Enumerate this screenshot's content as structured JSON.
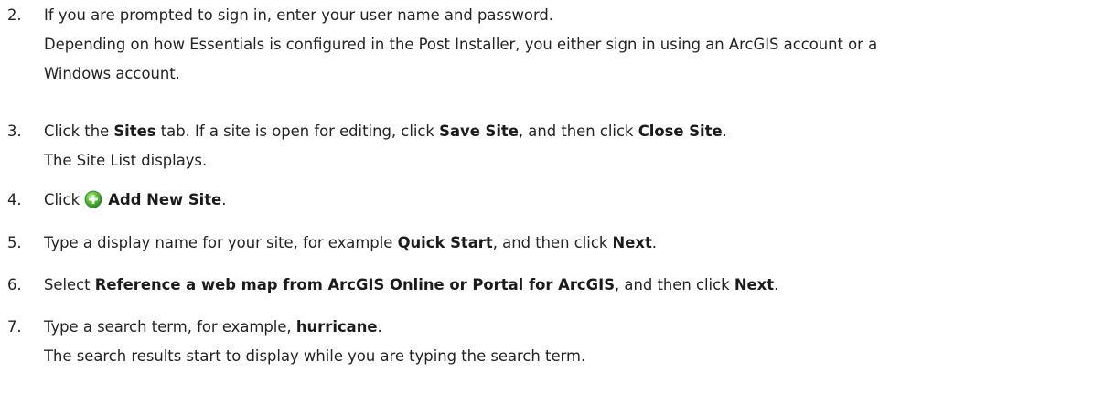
{
  "steps": [
    {
      "number": "2.",
      "parts": [
        "If you are prompted to sign in, enter your user name and password."
      ],
      "subtext": [
        "Depending on how Essentials is configured in the Post Installer, you either sign in using an ArcGIS account or a",
        "Windows account."
      ]
    },
    {
      "number": "3.",
      "parts": [
        "Click the ",
        "Sites",
        " tab. If a site is open for editing, click ",
        "Save Site",
        ", and then click ",
        "Close Site",
        "."
      ],
      "subtext": [
        "The Site List displays."
      ]
    },
    {
      "number": "4.",
      "parts": [
        "Click ",
        "Add New Site",
        "."
      ],
      "icon": "add-circle-icon"
    },
    {
      "number": "5.",
      "parts": [
        "Type a display name for your site, for example ",
        "Quick Start",
        ", and then click ",
        "Next",
        "."
      ]
    },
    {
      "number": "6.",
      "parts": [
        "Select ",
        "Reference a web map from ArcGIS Online or Portal for ArcGIS",
        ", and then click ",
        "Next",
        "."
      ]
    },
    {
      "number": "7.",
      "parts": [
        "Type a search term, for example, ",
        "hurricane",
        "."
      ],
      "subtext": [
        "The search results start to display while you are typing the search term."
      ]
    }
  ],
  "colors": {
    "text": "#222222",
    "icon_green": "#3fae29"
  }
}
